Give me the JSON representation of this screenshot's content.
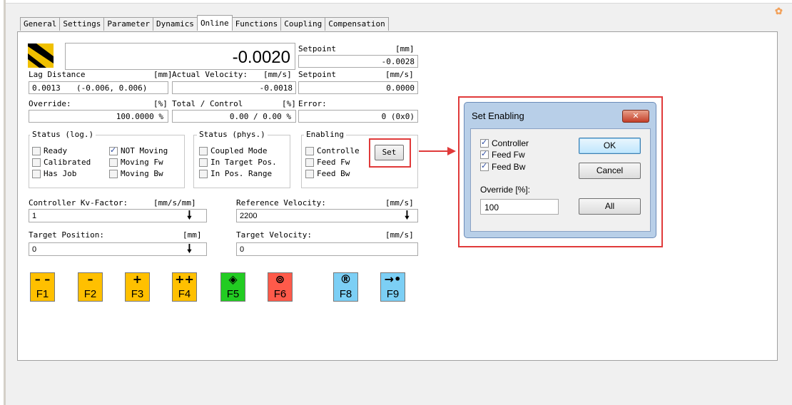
{
  "tabs": [
    "General",
    "Settings",
    "Parameter",
    "Dynamics",
    "Online",
    "Functions",
    "Coupling",
    "Compensation"
  ],
  "active_tab": "Online",
  "display": {
    "big_value": "-0.0020",
    "setpoint1_label": "Setpoint",
    "setpoint1_unit": "[mm]",
    "setpoint1_value": "-0.0028",
    "lag_label": "Lag Distance",
    "lag_unit": "[mm]",
    "lag_value": "0.0013",
    "lag_range": "(-0.006, 0.006)",
    "actvel_label": "Actual Velocity:",
    "actvel_unit": "[mm/s]",
    "actvel_value": "-0.0018",
    "setpoint2_label": "Setpoint",
    "setpoint2_unit": "[mm/s]",
    "setpoint2_value": "0.0000",
    "override_label": "Override:",
    "override_unit": "[%]",
    "override_value": "100.0000 %",
    "total_label": "Total / Control",
    "total_unit": "[%]",
    "total_value": "0.00 /  0.00 %",
    "error_label": "Error:",
    "error_value": "0 (0x0)"
  },
  "status_log": {
    "title": "Status (log.)",
    "items": [
      {
        "label": "Ready",
        "checked": false
      },
      {
        "label": "NOT Moving",
        "checked": true
      },
      {
        "label": "Calibrated",
        "checked": false
      },
      {
        "label": "Moving Fw",
        "checked": false
      },
      {
        "label": "Has Job",
        "checked": false
      },
      {
        "label": "Moving Bw",
        "checked": false
      }
    ]
  },
  "status_phys": {
    "title": "Status (phys.)",
    "items": [
      {
        "label": "Coupled Mode",
        "checked": false
      },
      {
        "label": "In Target Pos.",
        "checked": false
      },
      {
        "label": "In Pos. Range",
        "checked": false
      }
    ]
  },
  "enabling": {
    "title": "Enabling",
    "items": [
      {
        "label": "Controlle",
        "checked": false
      },
      {
        "label": "Feed Fw",
        "checked": false
      },
      {
        "label": "Feed Bw",
        "checked": false
      }
    ],
    "set_button": "Set"
  },
  "fields": {
    "kv_label": "Controller Kv-Factor:",
    "kv_unit": "[mm/s/mm]",
    "kv_value": "1",
    "refvel_label": "Reference Velocity:",
    "refvel_unit": "[mm/s]",
    "refvel_value": "2200",
    "tpos_label": "Target Position:",
    "tpos_unit": "[mm]",
    "tpos_value": "0",
    "tvel_label": "Target Velocity:",
    "tvel_unit": "[mm/s]",
    "tvel_value": "0"
  },
  "fkeys": [
    {
      "sym": "– –",
      "label": "F1",
      "color": "#ffc000"
    },
    {
      "sym": "–",
      "label": "F2",
      "color": "#ffc000"
    },
    {
      "sym": "+",
      "label": "F3",
      "color": "#ffc000"
    },
    {
      "sym": "++",
      "label": "F4",
      "color": "#ffc000"
    },
    {
      "sym": "◈",
      "label": "F5",
      "color": "#22cc22"
    },
    {
      "sym": "⊚",
      "label": "F6",
      "color": "#ff5a4a"
    },
    {
      "sym": "®",
      "label": "F8",
      "color": "#7ccff5"
    },
    {
      "sym": "→•",
      "label": "F9",
      "color": "#7ccff5"
    }
  ],
  "dialog": {
    "title": "Set Enabling",
    "close": "✕",
    "checks": [
      {
        "label": "Controller",
        "checked": true
      },
      {
        "label": "Feed Fw",
        "checked": true
      },
      {
        "label": "Feed Bw",
        "checked": true
      }
    ],
    "ok": "OK",
    "cancel": "Cancel",
    "override_label": "Override [%]:",
    "override_value": "100",
    "all": "All"
  },
  "colors": {
    "highlight": "#e03a3a",
    "dialog_frame": "#b8cfe8"
  }
}
